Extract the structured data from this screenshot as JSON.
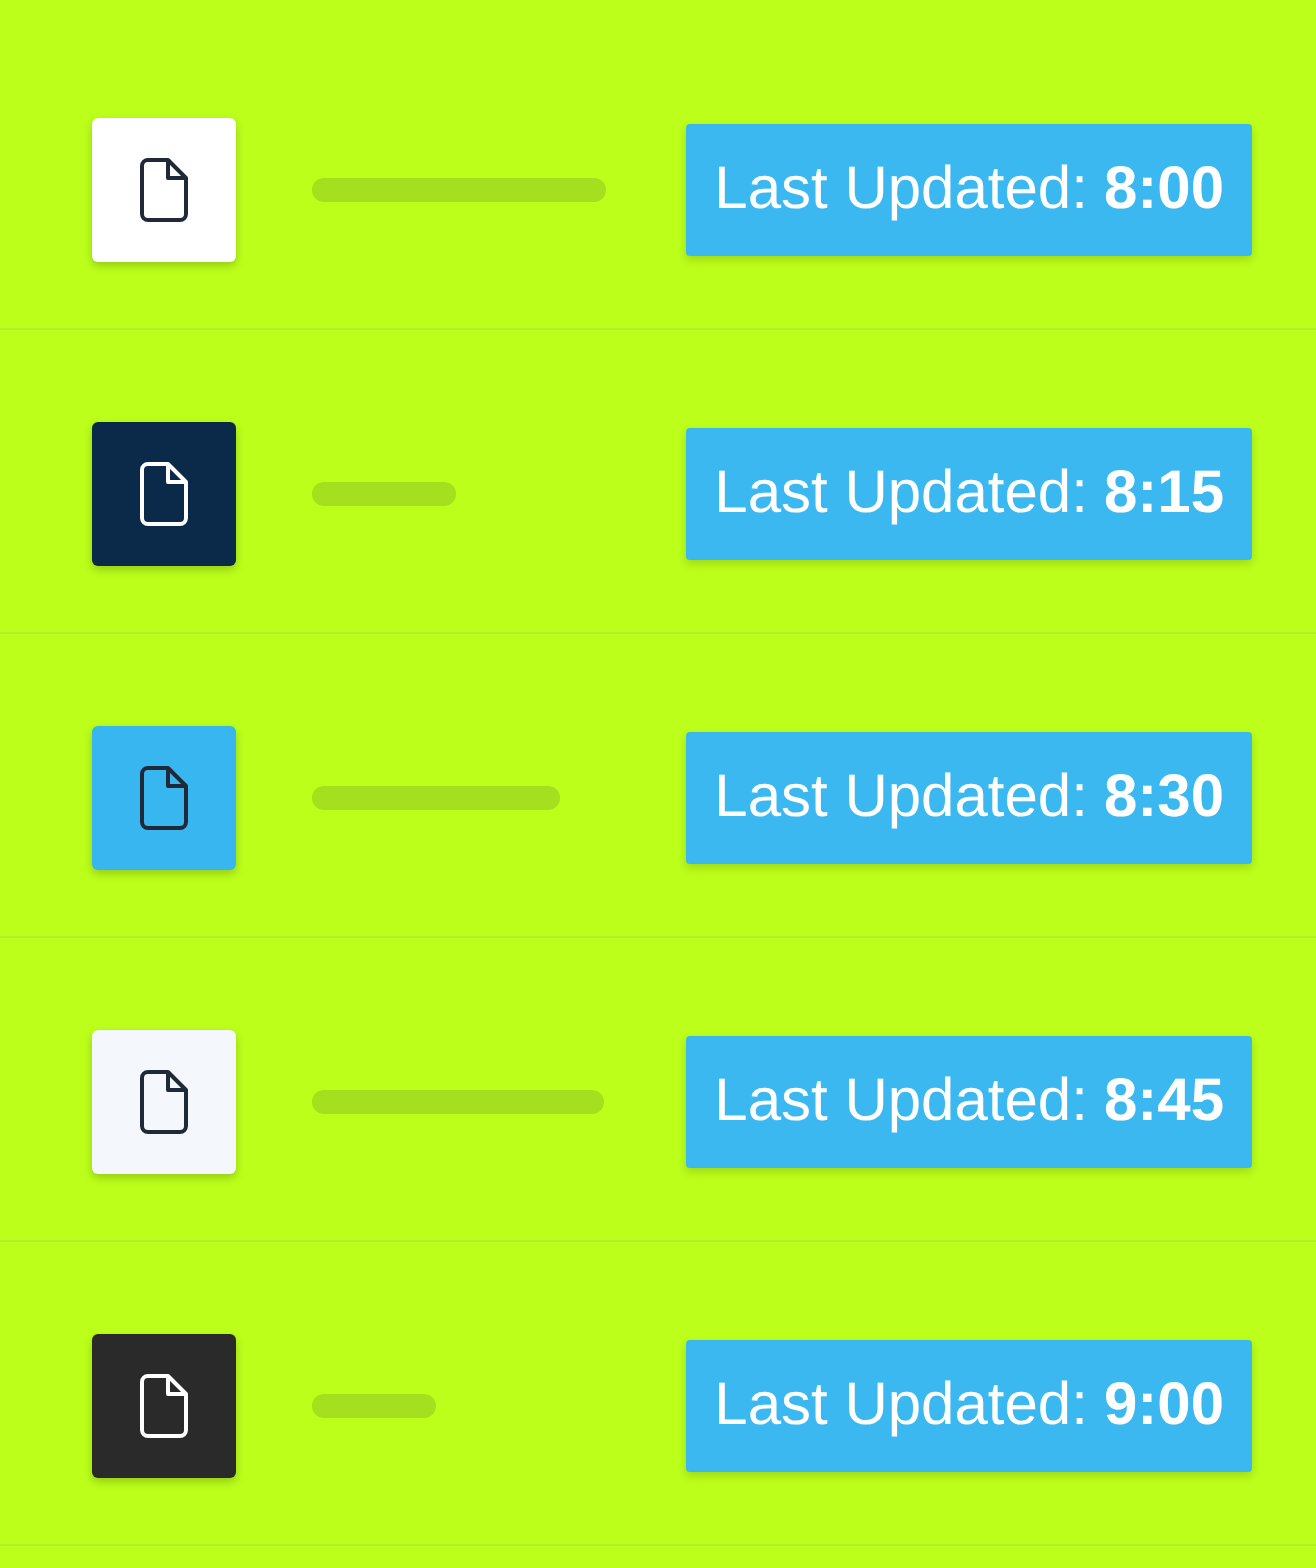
{
  "rows": [
    {
      "color": "#ffffff",
      "label": "Last Updated:",
      "time": "8:00"
    },
    {
      "color": "#0b2a4a",
      "label": "Last Updated:",
      "time": "8:15"
    },
    {
      "color": "#38b6f0",
      "label": "Last Updated:",
      "time": "8:30"
    },
    {
      "color": "#f4f8fc",
      "label": "Last Updated:",
      "time": "8:45"
    },
    {
      "color": "#2a2a2a",
      "label": "Last Updated:",
      "time": "9:00"
    }
  ]
}
